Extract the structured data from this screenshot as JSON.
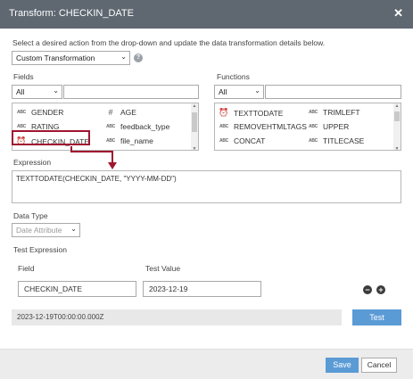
{
  "dialog": {
    "title": "Transform: CHECKIN_DATE"
  },
  "instructions": "Select a desired action from the drop-down and update the data transformation details below.",
  "action_select": {
    "value": "Custom Transformation"
  },
  "fields": {
    "label": "Fields",
    "filter": "All",
    "items": [
      {
        "label": "GENDER",
        "icon": "abc-icon"
      },
      {
        "label": "AGE",
        "icon": "hash-icon"
      },
      {
        "label": "RATING",
        "icon": "abc-icon"
      },
      {
        "label": "feedback_type",
        "icon": "abc-icon"
      },
      {
        "label": "CHECKIN_DATE",
        "icon": "clock-icon"
      },
      {
        "label": "file_name",
        "icon": "abc-icon"
      }
    ]
  },
  "functions": {
    "label": "Functions",
    "filter": "All",
    "items": [
      {
        "label": "TEXTTODATE",
        "icon": "clock-icon"
      },
      {
        "label": "TRIMLEFT",
        "icon": "abc-icon"
      },
      {
        "label": "REMOVEHTMLTAGS",
        "icon": "abc-icon"
      },
      {
        "label": "UPPER",
        "icon": "abc-icon"
      },
      {
        "label": "CONCAT",
        "icon": "abc-icon"
      },
      {
        "label": "TITLECASE",
        "icon": "abc-icon"
      }
    ]
  },
  "expression": {
    "label": "Expression",
    "value": "TEXTTODATE(CHECKIN_DATE, \"YYYY-MM-DD\")"
  },
  "data_type": {
    "label": "Data Type",
    "value": "Date Attribute"
  },
  "test_expression": {
    "label": "Test Expression",
    "field_header": "Field",
    "value_header": "Test Value",
    "field": "CHECKIN_DATE",
    "test_value": "2023-12-19",
    "result": "2023-12-19T00:00:00.000Z",
    "test_button": "Test"
  },
  "footer": {
    "save": "Save",
    "cancel": "Cancel"
  },
  "icons": {
    "abc-icon": "ABC",
    "hash-icon": "#",
    "clock-icon": "⏰"
  },
  "colors": {
    "titlebar": "#5f6771",
    "accent": "#5b9bd5",
    "highlight": "#a0142f"
  }
}
